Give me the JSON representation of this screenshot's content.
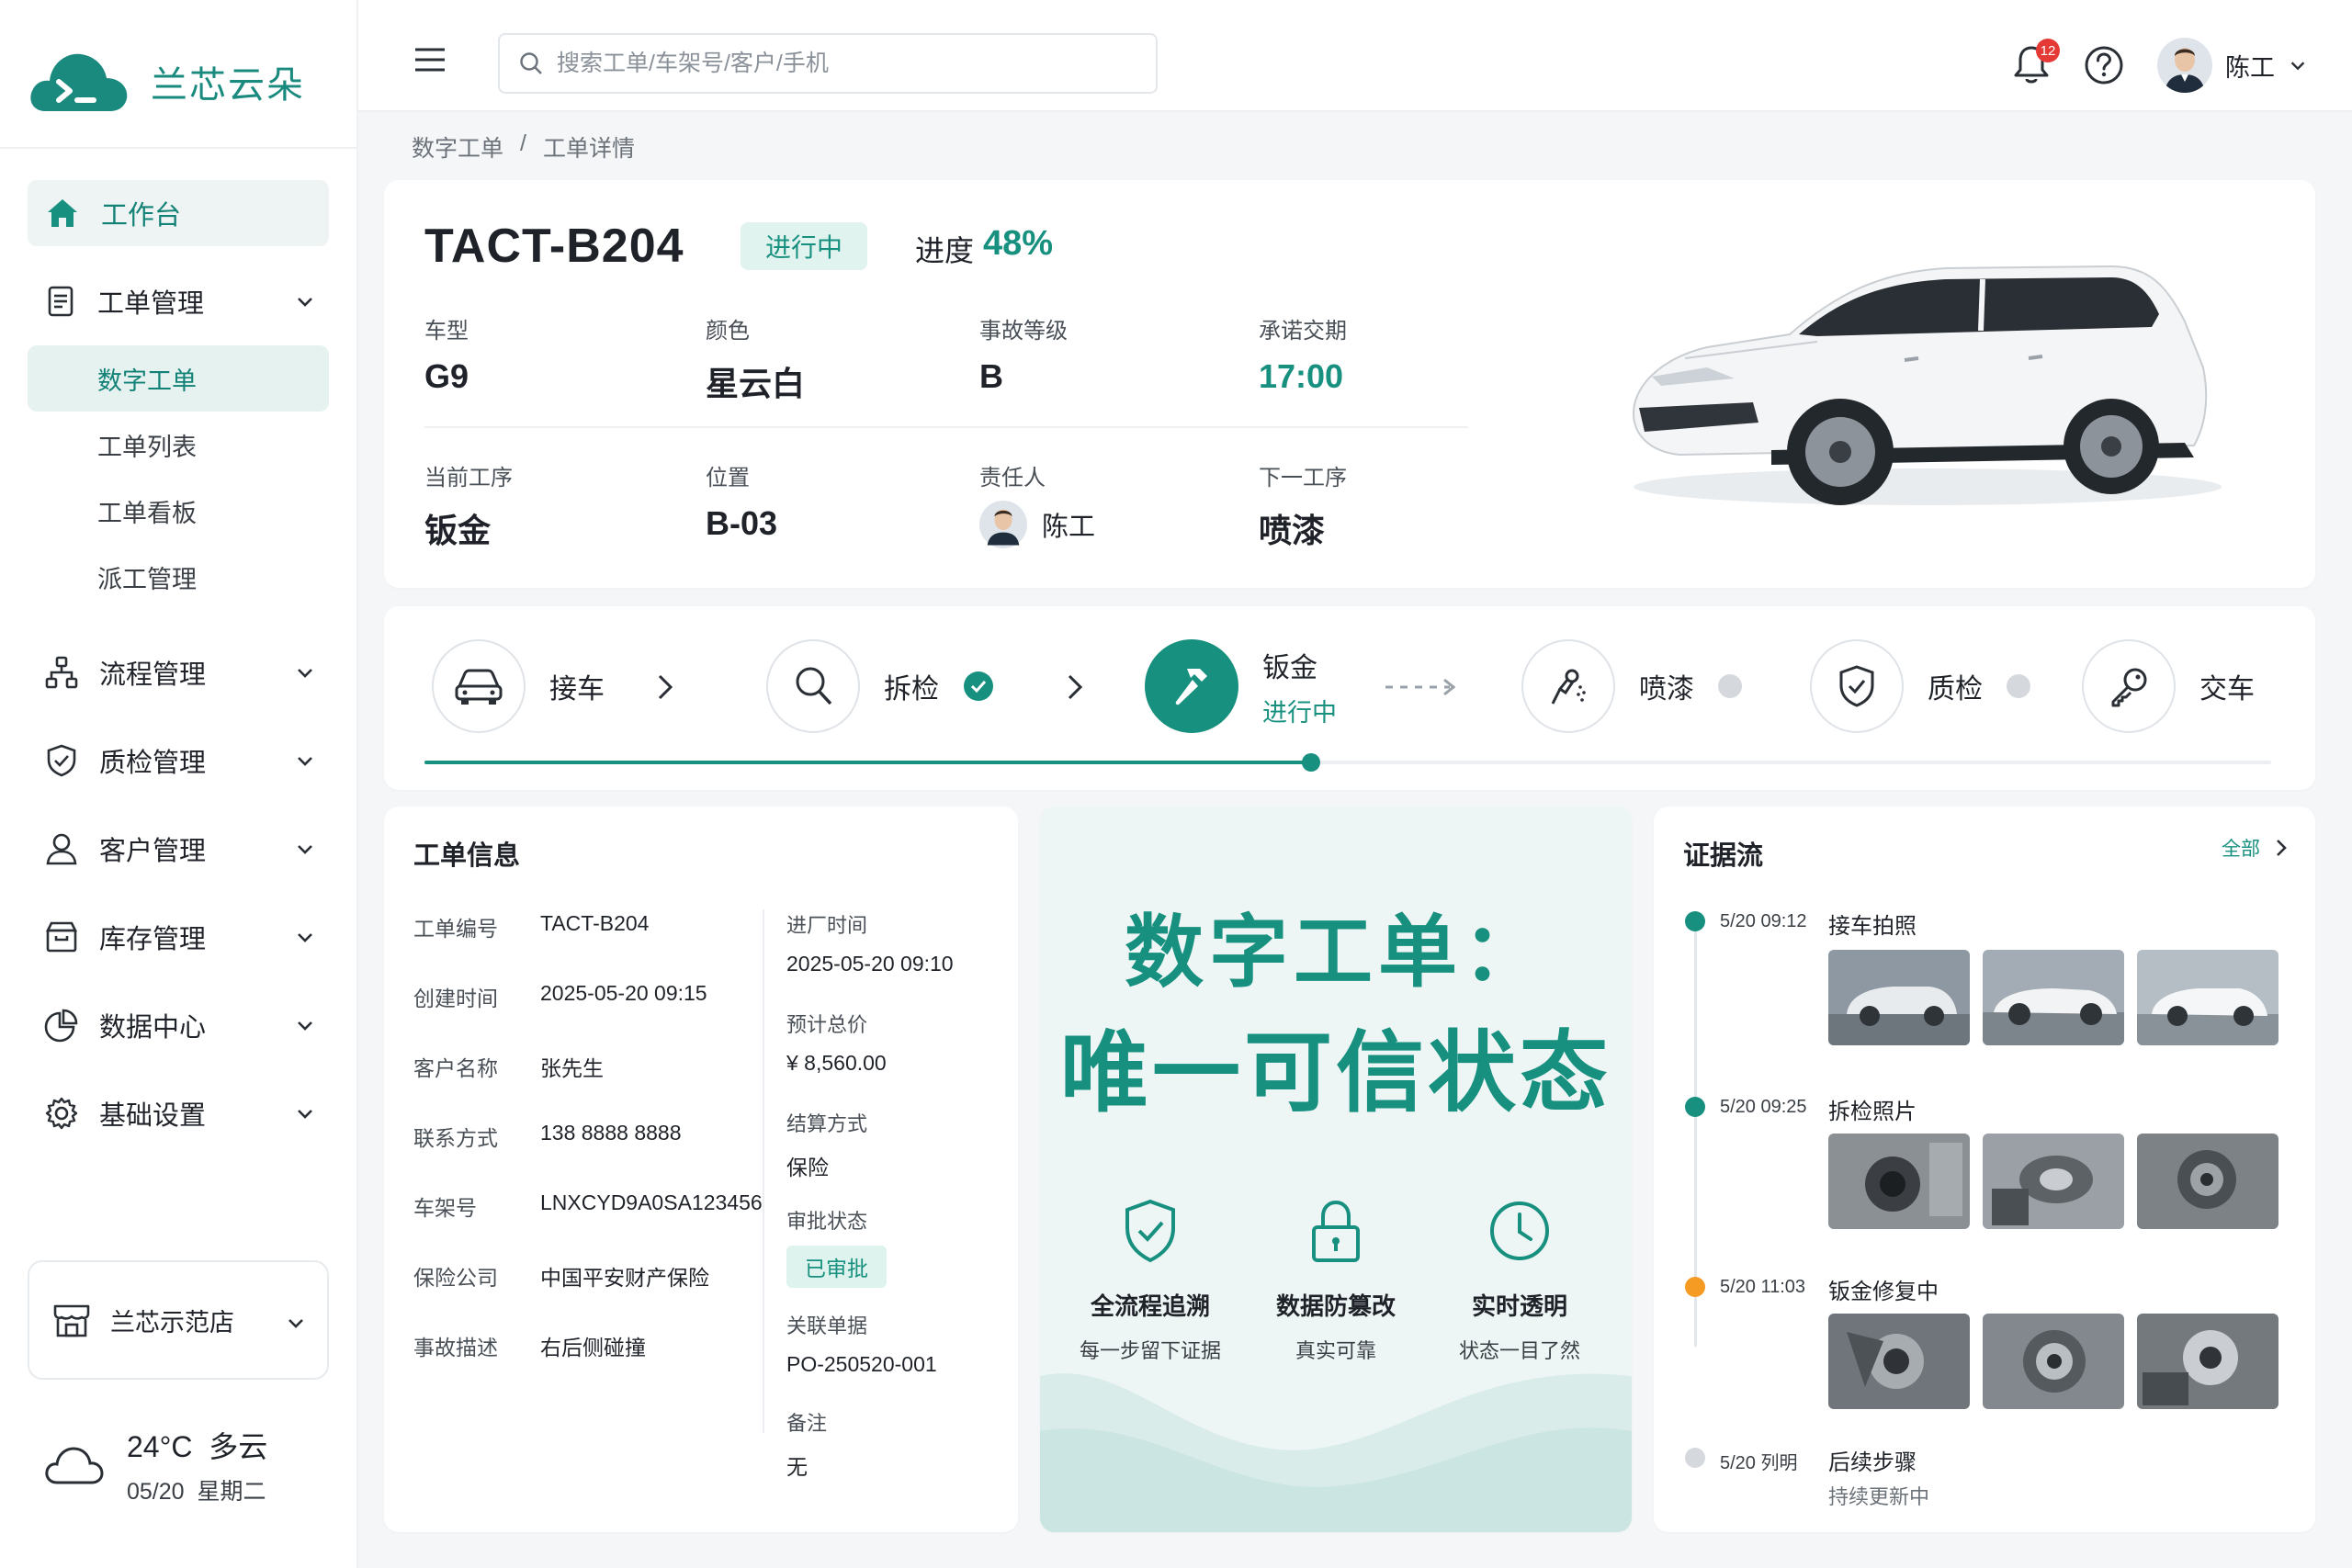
{
  "app": {
    "name": "兰芯云朵",
    "colors": {
      "brand": "#17907f",
      "accent_orange": "#f59a23",
      "notify": "#e53935"
    }
  },
  "sidebar": {
    "items": [
      {
        "label": "工作台",
        "icon": "home-icon",
        "active": true
      },
      {
        "label": "工单管理",
        "icon": "document-icon"
      },
      {
        "label": "流程管理",
        "icon": "flow-icon"
      },
      {
        "label": "质检管理",
        "icon": "shield-check-icon"
      },
      {
        "label": "客户管理",
        "icon": "user-icon"
      },
      {
        "label": "库存管理",
        "icon": "inventory-box-icon"
      },
      {
        "label": "数据中心",
        "icon": "pie-chart-icon"
      },
      {
        "label": "基础设置",
        "icon": "gear-icon"
      }
    ],
    "subitems": [
      "数字工单",
      "工单列表",
      "工单看板",
      "派工管理"
    ],
    "store": "兰芯示范店",
    "weather": {
      "temp": "24°C",
      "condition": "多云",
      "date": "05/20",
      "weekday": "星期二"
    }
  },
  "header": {
    "search_placeholder": "搜索工单/车架号/客户/手机",
    "notification_count": "12",
    "user_name": "陈工"
  },
  "breadcrumb": [
    "数字工单",
    "/",
    "工单详情"
  ],
  "order": {
    "id": "TACT-B204",
    "status": "进行中",
    "progress_label": "进度",
    "progress": "48%",
    "fields": {
      "model_label": "车型",
      "model": "G9",
      "color_label": "颜色",
      "color": "星云白",
      "level_label": "事故等级",
      "level": "B",
      "due_label": "承诺交期",
      "due": "17:00",
      "current_label": "当前工序",
      "current": "钣金",
      "location_label": "位置",
      "location": "B-03",
      "owner_label": "责任人",
      "owner": "陈工",
      "next_label": "下一工序",
      "next": "喷漆"
    }
  },
  "process": {
    "steps": [
      {
        "name": "接车",
        "state": "done"
      },
      {
        "name": "拆检",
        "state": "done"
      },
      {
        "name": "钣金",
        "state": "active",
        "sub": "进行中"
      },
      {
        "name": "喷漆",
        "state": "pending"
      },
      {
        "name": "质检",
        "state": "pending"
      },
      {
        "name": "交车",
        "state": "pending"
      }
    ],
    "progress_fraction": 0.48
  },
  "info": {
    "title": "工单信息",
    "left": [
      {
        "k": "工单编号",
        "v": "TACT-B204"
      },
      {
        "k": "创建时间",
        "v": "2025-05-20 09:15"
      },
      {
        "k": "客户名称",
        "v": "张先生"
      },
      {
        "k": "联系方式",
        "v": "138 8888 8888"
      },
      {
        "k": "车架号",
        "v": "LNXCYD9A0SA123456"
      },
      {
        "k": "保险公司",
        "v": "中国平安财产保险"
      },
      {
        "k": "事故描述",
        "v": "右后侧碰撞"
      }
    ],
    "right": [
      {
        "k": "进厂时间",
        "v": "2025-05-20 09:10"
      },
      {
        "k": "预计总价",
        "v": "¥ 8,560.00"
      },
      {
        "k": "结算方式",
        "v": "保险"
      },
      {
        "k": "审批状态",
        "v": "已审批"
      },
      {
        "k": "关联单据",
        "v": "PO-250520-001"
      },
      {
        "k": "备注",
        "v": "无"
      }
    ]
  },
  "promo": {
    "line1": "数字工单：",
    "line2": "唯一可信状态",
    "features": [
      {
        "title": "全流程追溯",
        "sub": "每一步留下证据",
        "icon": "shield-check-icon"
      },
      {
        "title": "数据防篡改",
        "sub": "真实可靠",
        "icon": "lock-icon"
      },
      {
        "title": "实时透明",
        "sub": "状态一目了然",
        "icon": "clock-icon"
      }
    ]
  },
  "evidence": {
    "title": "证据流",
    "all_label": "全部",
    "events": [
      {
        "time": "5/20 09:12",
        "title": "接车拍照",
        "state": "done"
      },
      {
        "time": "5/20 09:25",
        "title": "拆检照片",
        "state": "done"
      },
      {
        "time": "5/20 11:03",
        "title": "钣金修复中",
        "state": "active"
      },
      {
        "time": "5/20 列明",
        "title": "后续步骤",
        "sub": "持续更新中",
        "state": "pending"
      }
    ]
  }
}
